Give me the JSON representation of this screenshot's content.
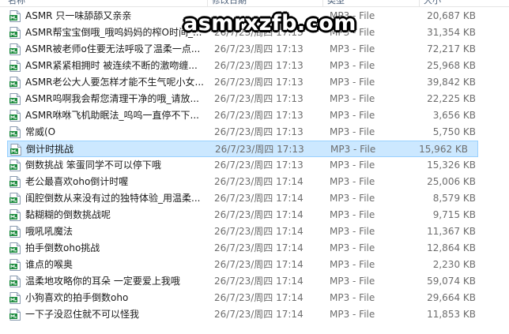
{
  "header": {
    "name": "名称",
    "date": "修改日期",
    "type": "类型",
    "size": "大小"
  },
  "watermark": "asmrxzfb.com",
  "files": [
    {
      "name": "ASMR 只一味舔舔又亲亲",
      "date": "",
      "type": "MP3 - File",
      "size": "20,687 KB"
    },
    {
      "name": "ASMR帮宝宝倒哦_哦呜妈妈的榨O时间_...",
      "date": "26/7/23/周四 17:13",
      "type": "MP3 - File",
      "size": "31,354 KB"
    },
    {
      "name": "ASMR被老师o住要无法呼吸了温柔一点...",
      "date": "26/7/23/周四 17:13",
      "type": "MP3 - File",
      "size": "72,217 KB"
    },
    {
      "name": "ASMR紧紧相拥时 被连续不断的激吻缠...",
      "date": "26/7/23/周四 17:13",
      "type": "MP3 - File",
      "size": "25,968 KB"
    },
    {
      "name": "ASMR老公大人要怎样才能不生气呢小女...",
      "date": "26/7/23/周四 17:13",
      "type": "MP3 - File",
      "size": "39,842 KB"
    },
    {
      "name": "ASMR呜啊我会帮您清理干净的哦_请放...",
      "date": "26/7/23/周四 17:13",
      "type": "MP3 - File",
      "size": "22,225 KB"
    },
    {
      "name": "ASMR咻咻飞机助眠法_呜呜一直停不下...",
      "date": "26/7/23/周四 17:13",
      "type": "MP3 - File",
      "size": "3,656 KB"
    },
    {
      "name": "常威(O",
      "date": "26/7/23/周四 17:13",
      "type": "MP3 - File",
      "size": "5,750 KB"
    },
    {
      "name": "倒计时挑战",
      "date": "26/7/23/周四 17:13",
      "type": "MP3 - File",
      "size": "15,962 KB",
      "selected": true
    },
    {
      "name": "倒数挑战 笨蛋同学不可以停下哦",
      "date": "26/7/23/周四 17:13",
      "type": "MP3 - File",
      "size": "15,326 KB"
    },
    {
      "name": "老公最喜欢oho倒计时喔",
      "date": "26/7/23/周四 17:14",
      "type": "MP3 - File",
      "size": "25,006 KB"
    },
    {
      "name": "闺腔倒数从来没有过的独特体验_用温柔...",
      "date": "26/7/23/周四 17:14",
      "type": "MP3 - File",
      "size": "8,579 KB"
    },
    {
      "name": "黏糊糊的倒数挑战呢",
      "date": "26/7/23/周四 17:14",
      "type": "MP3 - File",
      "size": "9,715 KB"
    },
    {
      "name": "哦吼吼魔法",
      "date": "26/7/23/周四 17:14",
      "type": "MP3 - File",
      "size": "11,367 KB"
    },
    {
      "name": "拍手倒数oho挑战",
      "date": "26/7/23/周四 17:14",
      "type": "MP3 - File",
      "size": "12,864 KB"
    },
    {
      "name": "谁点的喉奥",
      "date": "26/7/23/周四 17:14",
      "type": "MP3 - File",
      "size": "2,230 KB"
    },
    {
      "name": "温柔地攻略你的耳朵 一定要爱上我哦",
      "date": "26/7/23/周四 17:14",
      "type": "MP3 - File",
      "size": "59,074 KB"
    },
    {
      "name": "小狗喜欢的拍手倒数oho",
      "date": "26/7/23/周四 17:14",
      "type": "MP3 - File",
      "size": "29,664 KB"
    },
    {
      "name": "一下子没忍住就不可以怪我",
      "date": "26/7/23/周四 17:14",
      "type": "MP3 - File",
      "size": "11,853 KB"
    }
  ]
}
